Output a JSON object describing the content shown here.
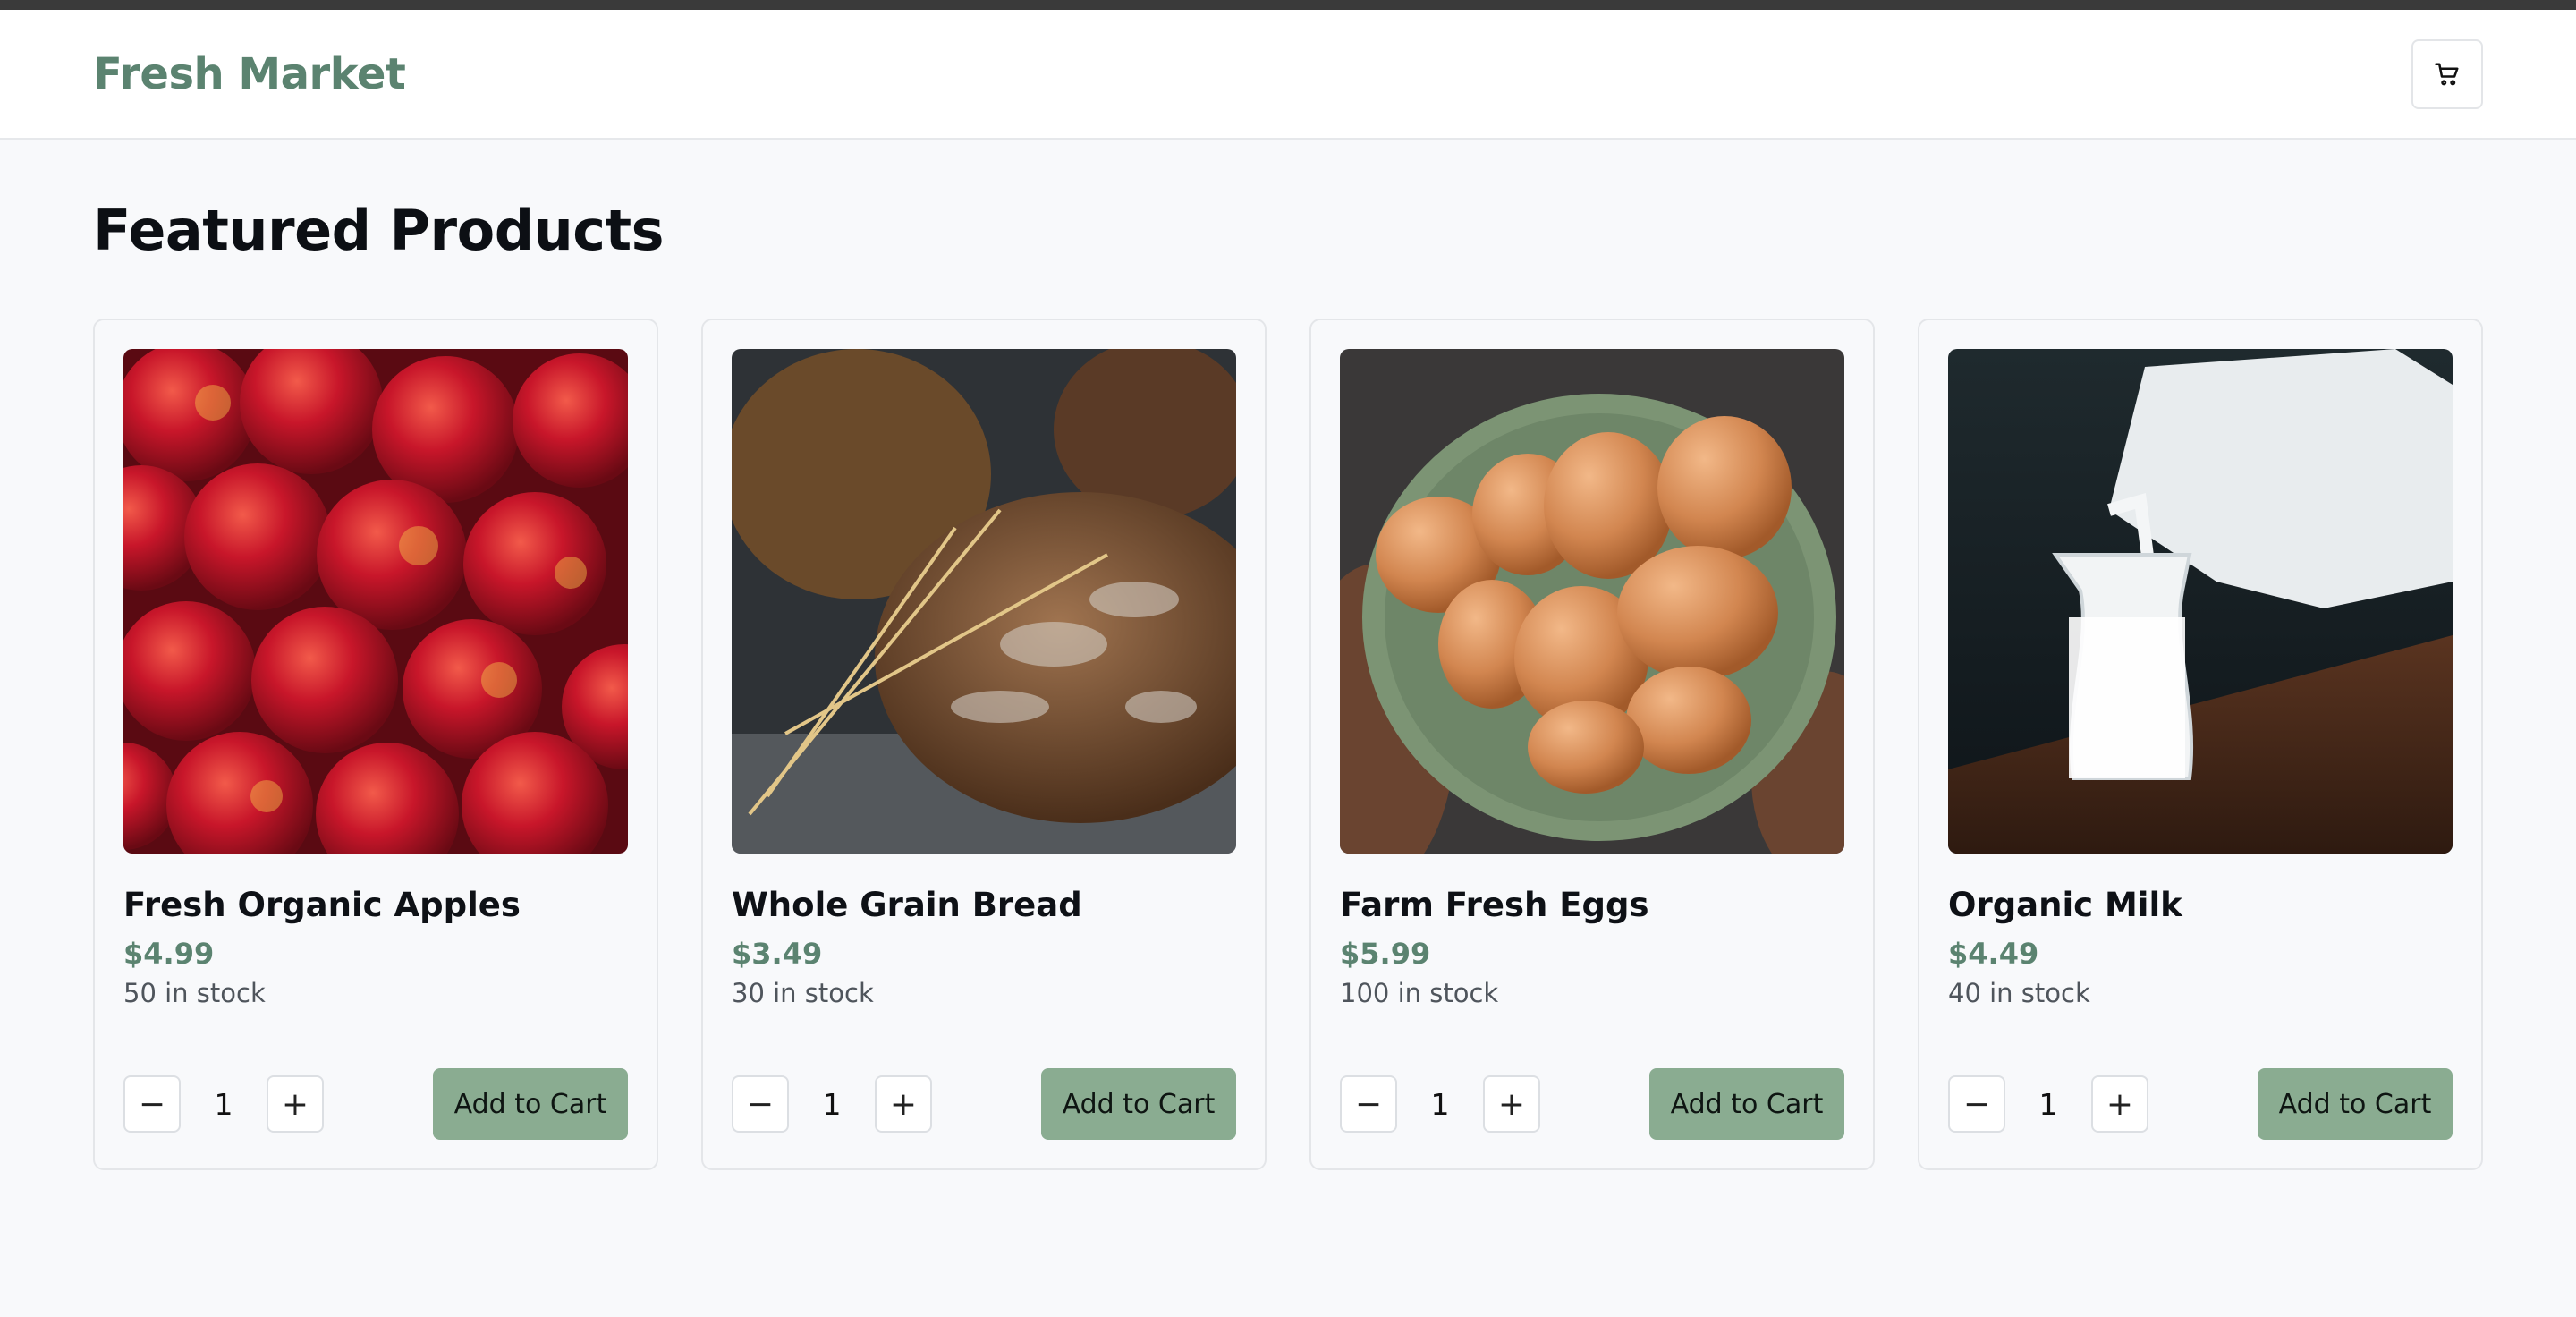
{
  "header": {
    "brand": "Fresh Market",
    "cart_icon": "shopping-cart-icon"
  },
  "main": {
    "title": "Featured Products"
  },
  "products": [
    {
      "name": "Fresh Organic Apples",
      "price": "$4.99",
      "stock": "50 in stock",
      "quantity": "1",
      "decrement": "−",
      "increment": "+",
      "add_label": "Add to Cart",
      "image": "apples-photo"
    },
    {
      "name": "Whole Grain Bread",
      "price": "$3.49",
      "stock": "30 in stock",
      "quantity": "1",
      "decrement": "−",
      "increment": "+",
      "add_label": "Add to Cart",
      "image": "bread-photo"
    },
    {
      "name": "Farm Fresh Eggs",
      "price": "$5.99",
      "stock": "100 in stock",
      "quantity": "1",
      "decrement": "−",
      "increment": "+",
      "add_label": "Add to Cart",
      "image": "eggs-photo"
    },
    {
      "name": "Organic Milk",
      "price": "$4.49",
      "stock": "40 in stock",
      "quantity": "1",
      "decrement": "−",
      "increment": "+",
      "add_label": "Add to Cart",
      "image": "milk-photo"
    }
  ],
  "colors": {
    "brand": "#5b8370",
    "price": "#5b8370",
    "button": "#8aac91",
    "background": "#f8f9fb"
  }
}
